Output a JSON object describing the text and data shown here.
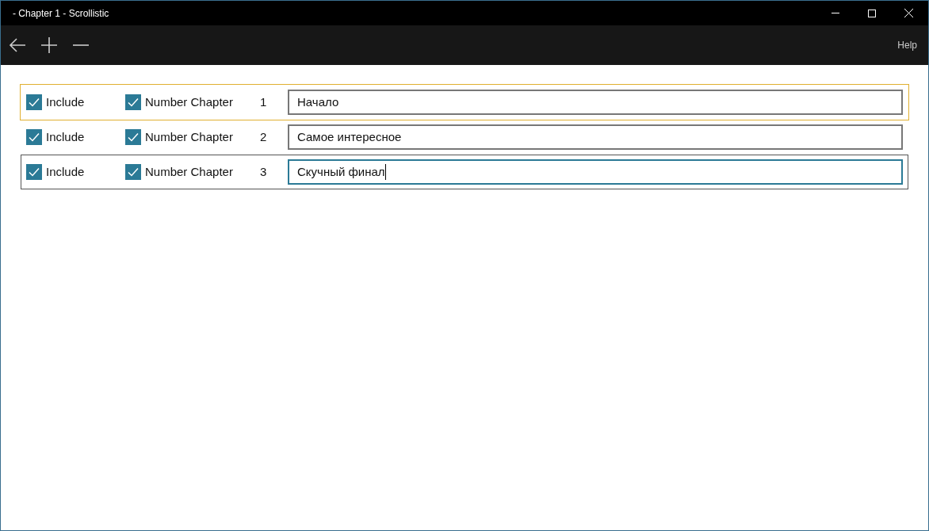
{
  "window": {
    "title": "- Chapter 1 - Scrollistic"
  },
  "toolbar": {
    "help": "Help"
  },
  "chapters": [
    {
      "include": {
        "label": "Include",
        "checked": true
      },
      "number_chapter": {
        "label": "Number Chapter",
        "checked": true
      },
      "number": "1",
      "title": {
        "value": "Начало",
        "focused": false
      },
      "selected": false,
      "hovered": true
    },
    {
      "include": {
        "label": "Include",
        "checked": true
      },
      "number_chapter": {
        "label": "Number Chapter",
        "checked": true
      },
      "number": "2",
      "title": {
        "value": "Самое интересное",
        "focused": false
      },
      "selected": false,
      "hovered": false
    },
    {
      "include": {
        "label": "Include",
        "checked": true
      },
      "number_chapter": {
        "label": "Number Chapter",
        "checked": true
      },
      "number": "3",
      "title": {
        "value": "Скучный финал",
        "focused": true
      },
      "selected": true,
      "hovered": false
    }
  ]
}
